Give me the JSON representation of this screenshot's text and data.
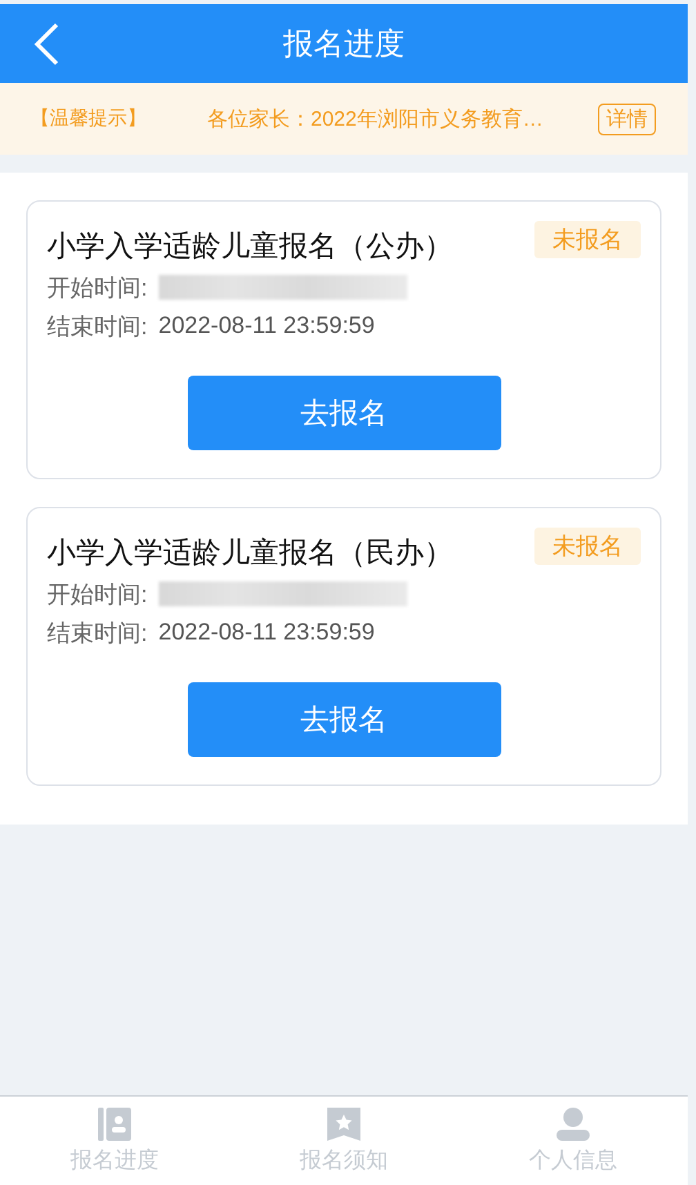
{
  "header": {
    "title": "报名进度"
  },
  "notice": {
    "label": "【温馨提示】",
    "text": "各位家长：2022年浏阳市义务教育…",
    "button": "详情"
  },
  "cards": [
    {
      "title": "小学入学适龄儿童报名（公办）",
      "status": "未报名",
      "start_label": "开始时间:",
      "end_label": "结束时间:",
      "end_value": "2022-08-11 23:59:59",
      "button": "去报名"
    },
    {
      "title": "小学入学适龄儿童报名（民办）",
      "status": "未报名",
      "start_label": "开始时间:",
      "end_label": "结束时间:",
      "end_value": "2022-08-11 23:59:59",
      "button": "去报名"
    }
  ],
  "tabbar": [
    {
      "label": "报名进度",
      "kind": "contact",
      "selected": false
    },
    {
      "label": "报名须知",
      "kind": "bookmark",
      "selected": false
    },
    {
      "label": "个人信息",
      "kind": "person",
      "selected": false
    }
  ]
}
